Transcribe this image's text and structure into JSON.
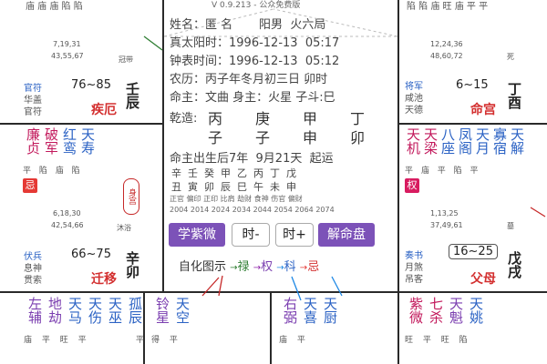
{
  "top": {
    "left_partial": "庙 庙 庙 陷 陷",
    "version": "V 0.9.213 - 公众免费版",
    "right_partial": "陷 陷 庙 旺   庙 平 平"
  },
  "center": {
    "lines": [
      "姓名：匿 名       阳男  火六局",
      "真太阳时：1996-12-13  05:17",
      "钟表时间：1996-12-13  05:12",
      "农历：丙子年冬月初三日 卯时",
      "命主：文曲 身主：火星 子斗:巳"
    ],
    "qianzao_label": "乾造:",
    "pillars_top": [
      "丙",
      "庚",
      "甲",
      "丁"
    ],
    "pillars_bottom": [
      "子",
      "子",
      "申",
      "卯"
    ],
    "dayun_line": "命主出生后7年  9月21天  起运",
    "stems": "辛  壬  癸  甲  乙  丙  丁  戊",
    "branches": "丑  寅  卯  辰  巳  午  未  申",
    "gods": "正官 偏印 正印 比肩 劫财 食神 伤官 偏财",
    "years": "2004 2014 2024 2034 2044 2054 2064 2074",
    "btn_learn": "学紫微",
    "btn_prev": "时-",
    "btn_next": "时+",
    "btn_decode": "解命盘",
    "legend_label": "自化图示",
    "legend_items": [
      "禄",
      "权",
      "科",
      "忌"
    ],
    "legend_arrow": "→"
  },
  "palace_wuchen": {
    "years_a": "7,19,31",
    "years_b": "43,55,67",
    "stage": "冠带",
    "god1": "官符",
    "god2": "华盖",
    "god3": "官符",
    "range": "76~85",
    "name": "疾厄",
    "gz_top": "壬",
    "gz_bottom": "辰"
  },
  "palace_you": {
    "years_a": "12,24,36",
    "years_b": "48,60,72",
    "stage": "死",
    "god1": "将军",
    "god2": "咸池",
    "god3": "天德",
    "range": "6~15",
    "name": "命宫",
    "gz_top": "丁",
    "gz_bottom": "酉"
  },
  "palace_mao": {
    "stars": [
      "廉贞",
      "破军",
      "红鸾",
      "天寿"
    ],
    "bright": "平 陷 庙 陷",
    "badge": "忌",
    "body_tag": "身宫",
    "years_a": "6,18,30",
    "years_b": "42,54,66",
    "stage": "沐浴",
    "god1": "伏兵",
    "god2": "息神",
    "god3": "贯索",
    "range": "66~75",
    "name": "迁移",
    "gz_top": "辛",
    "gz_bottom": "卯"
  },
  "palace_xu": {
    "stars": [
      "天机",
      "天梁",
      "八座",
      "凤阁",
      "天月",
      "寡宿",
      "天解"
    ],
    "bright": "平 庙 平   陷 平",
    "badge": "权",
    "years_a": "1,13,25",
    "years_b": "37,49,61",
    "stage": "墓",
    "god1": "奏书",
    "god2": "月煞",
    "god3": "吊客",
    "range": "16~25",
    "name": "父母",
    "gz_top": "戊",
    "gz_bottom": "戌"
  },
  "bottom": {
    "c1_stars": [
      "左辅",
      "地劫",
      "天马",
      "天伤",
      "天巫",
      "孤辰"
    ],
    "c1_bright": "庙 平 旺 平     平",
    "c2_stars": [
      "铃星",
      "天空"
    ],
    "c2_bright": "得 平",
    "c3_stars": [
      "右弼",
      "天喜",
      "天厨"
    ],
    "c3_bright": "庙 平",
    "c4_stars": [
      "紫微",
      "七杀",
      "天魁",
      "天姚"
    ],
    "c4_bright": "旺 平 旺 陷"
  },
  "colors": {
    "purple": "#7c52b8",
    "red": "#d32f2f",
    "pink": "#c2185b",
    "grid": "#2a2a2a"
  }
}
